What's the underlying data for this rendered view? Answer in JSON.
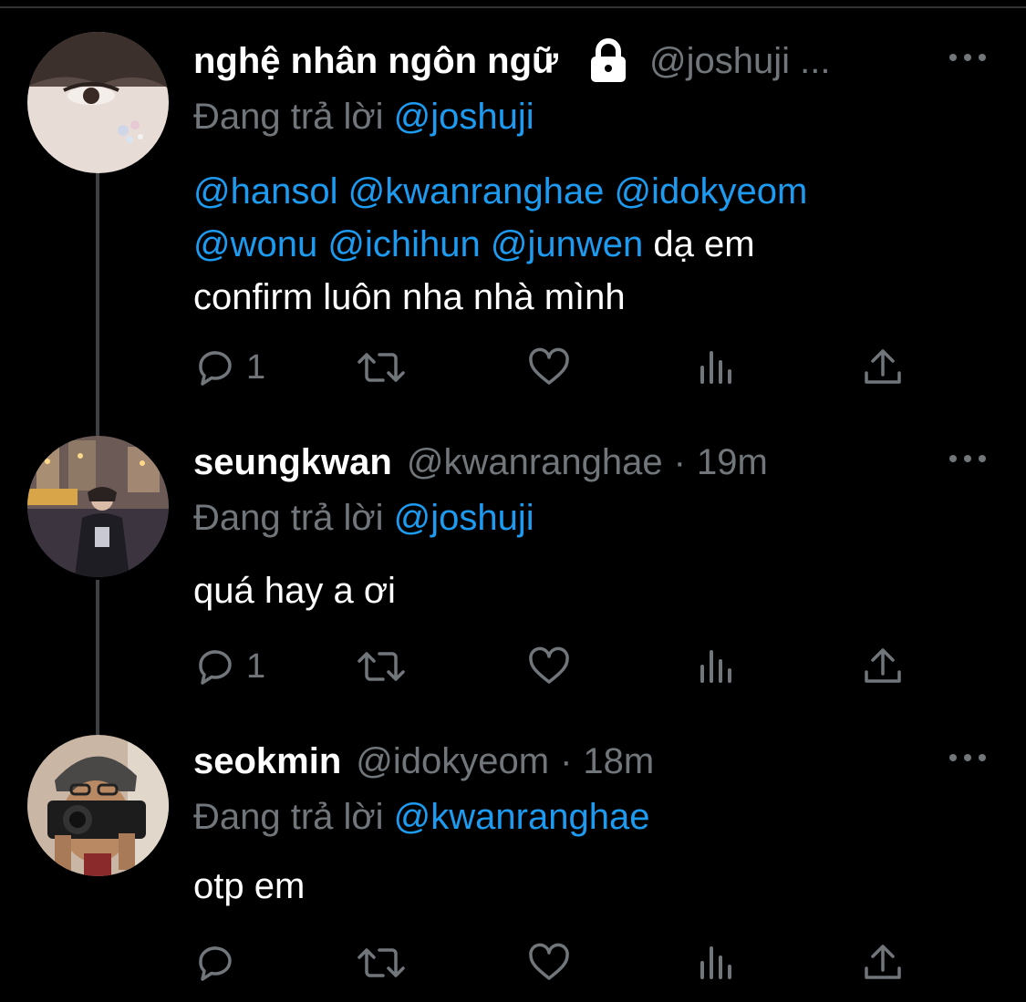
{
  "tweets": [
    {
      "name": "nghệ nhân ngôn ngữ",
      "locked": true,
      "handle": "@joshuji ...",
      "replying_prefix": "Đang trả lời",
      "replying_to": "@joshuji",
      "body_mentions": [
        "@hansol",
        "@kwanranghae",
        "@idokyeom",
        "@wonu",
        "@ichihun",
        "@junwen"
      ],
      "body_text_1": "dạ em",
      "body_text_2": "confirm luôn nha nhà mình",
      "reply_count": "1",
      "avatar_icon": "avatar-eye-closeup"
    },
    {
      "name": "seungkwan",
      "handle": "@kwanranghae",
      "separator": "·",
      "time": "19m",
      "replying_prefix": "Đang trả lời",
      "replying_to": "@joshuji",
      "body": "quá hay a ơi",
      "reply_count": "1",
      "avatar_icon": "avatar-night-city"
    },
    {
      "name": "seokmin",
      "handle": "@idokyeom",
      "separator": "·",
      "time": "18m",
      "replying_prefix": "Đang trả lời",
      "replying_to": "@kwanranghae",
      "body": "otp em",
      "reply_count": "",
      "avatar_icon": "avatar-camera-selfie"
    }
  ],
  "icons": {
    "reply": "reply-icon",
    "retweet": "retweet-icon",
    "like": "heart-icon",
    "views": "views-icon",
    "share": "share-icon",
    "more": "more-icon",
    "lock": "lock-icon"
  },
  "colors": {
    "background": "#000000",
    "text": "#ffffff",
    "muted": "#71767b",
    "link": "#1d9bf0",
    "thread_line": "#3e4144"
  }
}
